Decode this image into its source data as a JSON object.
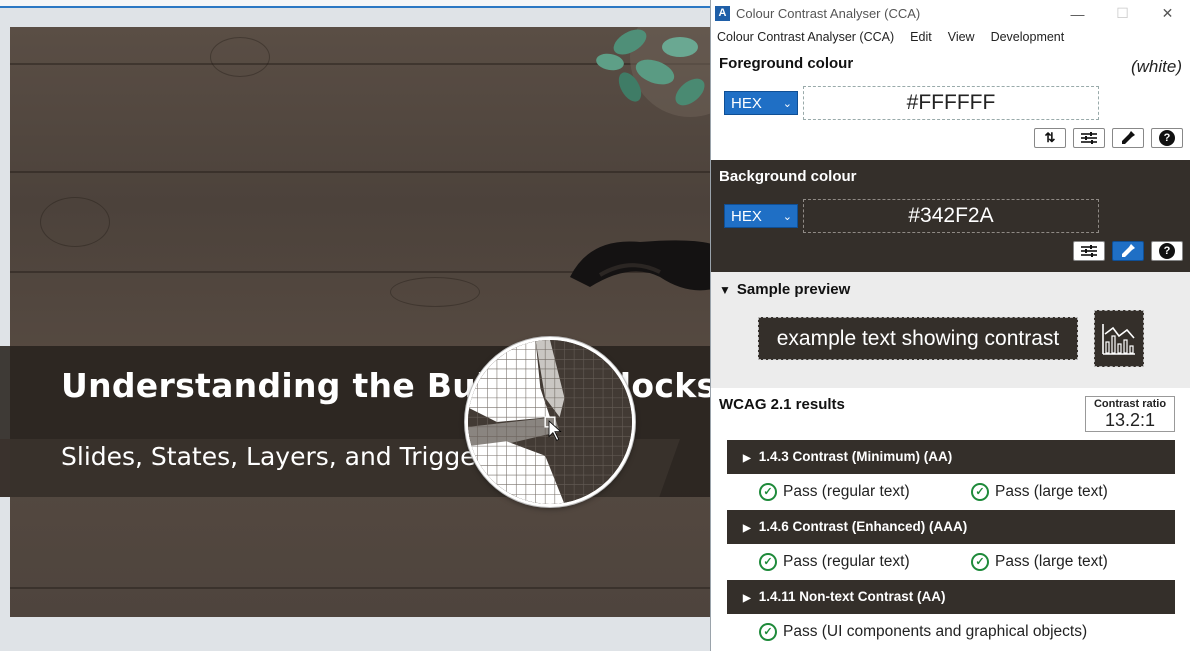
{
  "slide": {
    "title": "Understanding the Building Blocks",
    "subtitle": "Slides, States, Layers, and Triggers"
  },
  "cca": {
    "window_title": "Colour Contrast Analyser (CCA)",
    "app_icon": "cca-logo-icon",
    "menu": [
      "Colour Contrast Analyser (CCA)",
      "Edit",
      "View",
      "Development"
    ],
    "foreground": {
      "title": "Foreground colour",
      "name": "(white)",
      "format": "HEX",
      "value": "#FFFFFF",
      "tools": [
        "swap-icon",
        "sliders-icon",
        "eyedropper-icon",
        "help-icon"
      ]
    },
    "background": {
      "title": "Background colour",
      "format": "HEX",
      "value": "#342F2A",
      "tools": [
        "sliders-icon",
        "eyedropper-icon",
        "help-icon"
      ]
    },
    "preview": {
      "title": "Sample preview",
      "sample_text": "example text showing contrast"
    },
    "results": {
      "title": "WCAG 2.1 results",
      "ratio_label": "Contrast ratio",
      "ratio_value": "13.2:1",
      "criteria": [
        {
          "label": "1.4.3 Contrast (Minimum) (AA)",
          "results": [
            "Pass (regular text)",
            "Pass (large text)"
          ]
        },
        {
          "label": "1.4.6 Contrast (Enhanced) (AAA)",
          "results": [
            "Pass (regular text)",
            "Pass (large text)"
          ]
        },
        {
          "label": "1.4.11 Non-text Contrast (AA)",
          "results": [
            "Pass (UI components and graphical objects)"
          ]
        }
      ]
    },
    "colors": {
      "background": "#342F2A",
      "accent": "#1F6FC5",
      "pass": "#1E8A3A"
    }
  }
}
